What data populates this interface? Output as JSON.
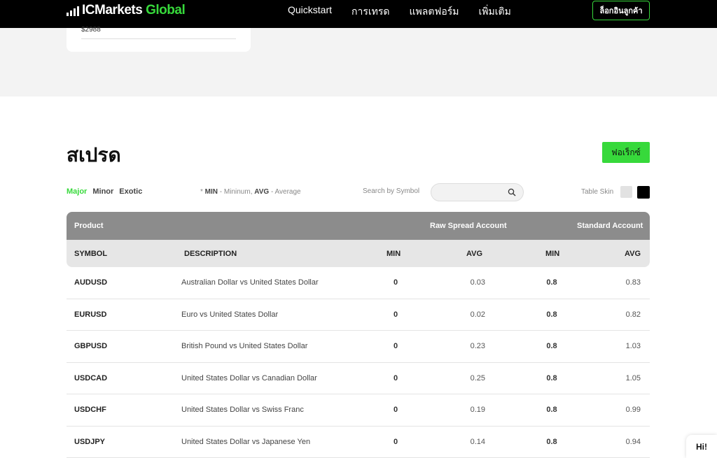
{
  "header": {
    "logo": {
      "ic": "IC",
      "markets": "Markets",
      "global": "Global"
    },
    "nav": [
      "Quickstart",
      "การเทรด",
      "แพลตฟอร์ม",
      "เพิ่มเติม"
    ],
    "login_label": "ล็อกอินลูกค้า"
  },
  "card": {
    "price": "$2988"
  },
  "spreads": {
    "title": "สเปรด",
    "forex_button": "ฟอเร็กซ์",
    "filters": [
      "Major",
      "Minor",
      "Exotic"
    ],
    "legend": {
      "prefix": "* ",
      "min_key": "MIN",
      "min_text": " - Mininum, ",
      "avg_key": "AVG",
      "avg_text": " - Average"
    },
    "search_label": "Search by Symbol",
    "search_placeholder": "",
    "skin_label": "Table Skin"
  },
  "table": {
    "group_headers": {
      "product": "Product",
      "raw": "Raw Spread Account",
      "standard": "Standard Account"
    },
    "columns": {
      "symbol": "SYMBOL",
      "description": "DESCRIPTION",
      "raw_min": "MIN",
      "raw_avg": "AVG",
      "std_min": "MIN",
      "std_avg": "AVG"
    },
    "rows": [
      {
        "symbol": "AUDUSD",
        "description": "Australian Dollar vs United States Dollar",
        "raw_min": "0",
        "raw_avg": "0.03",
        "std_min": "0.8",
        "std_avg": "0.83"
      },
      {
        "symbol": "EURUSD",
        "description": "Euro vs United States Dollar",
        "raw_min": "0",
        "raw_avg": "0.02",
        "std_min": "0.8",
        "std_avg": "0.82"
      },
      {
        "symbol": "GBPUSD",
        "description": "British Pound vs United States Dollar",
        "raw_min": "0",
        "raw_avg": "0.23",
        "std_min": "0.8",
        "std_avg": "1.03"
      },
      {
        "symbol": "USDCAD",
        "description": "United States Dollar vs Canadian Dollar",
        "raw_min": "0",
        "raw_avg": "0.25",
        "std_min": "0.8",
        "std_avg": "1.05"
      },
      {
        "symbol": "USDCHF",
        "description": "United States Dollar vs Swiss Franc",
        "raw_min": "0",
        "raw_avg": "0.19",
        "std_min": "0.8",
        "std_avg": "0.99"
      },
      {
        "symbol": "USDJPY",
        "description": "United States Dollar vs Japanese Yen",
        "raw_min": "0",
        "raw_avg": "0.14",
        "std_min": "0.8",
        "std_avg": "0.94"
      }
    ]
  },
  "chat": {
    "label": "Hi!"
  },
  "colors": {
    "accent": "#37d93b",
    "header_bg": "#000000",
    "table_header": "#8c8c8c"
  }
}
